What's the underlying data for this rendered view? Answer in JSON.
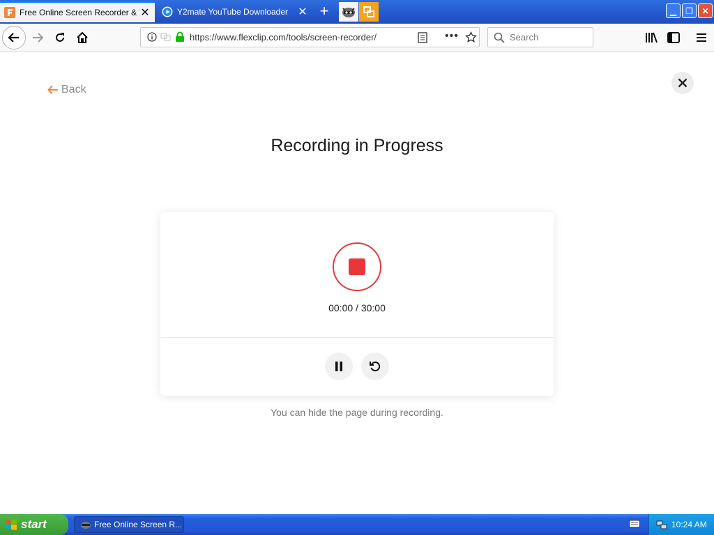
{
  "browser": {
    "tabs": [
      {
        "title": "Free Online Screen Recorder & We",
        "active": true
      },
      {
        "title": "Y2mate YouTube Downloader",
        "active": false
      }
    ],
    "url": "https://www.flexclip.com/tools/screen-recorder/",
    "search_placeholder": "Search"
  },
  "page": {
    "back_label": "Back",
    "title": "Recording in Progress",
    "timer": "00:00 / 30:00",
    "hint": "You can hide the page during recording."
  },
  "taskbar": {
    "start_label": "start",
    "task_label": "Free Online Screen R...",
    "clock": "10:24 AM"
  },
  "colors": {
    "record_red": "#e9363a",
    "accent_orange": "#f0883a",
    "xp_blue": "#245edb"
  }
}
